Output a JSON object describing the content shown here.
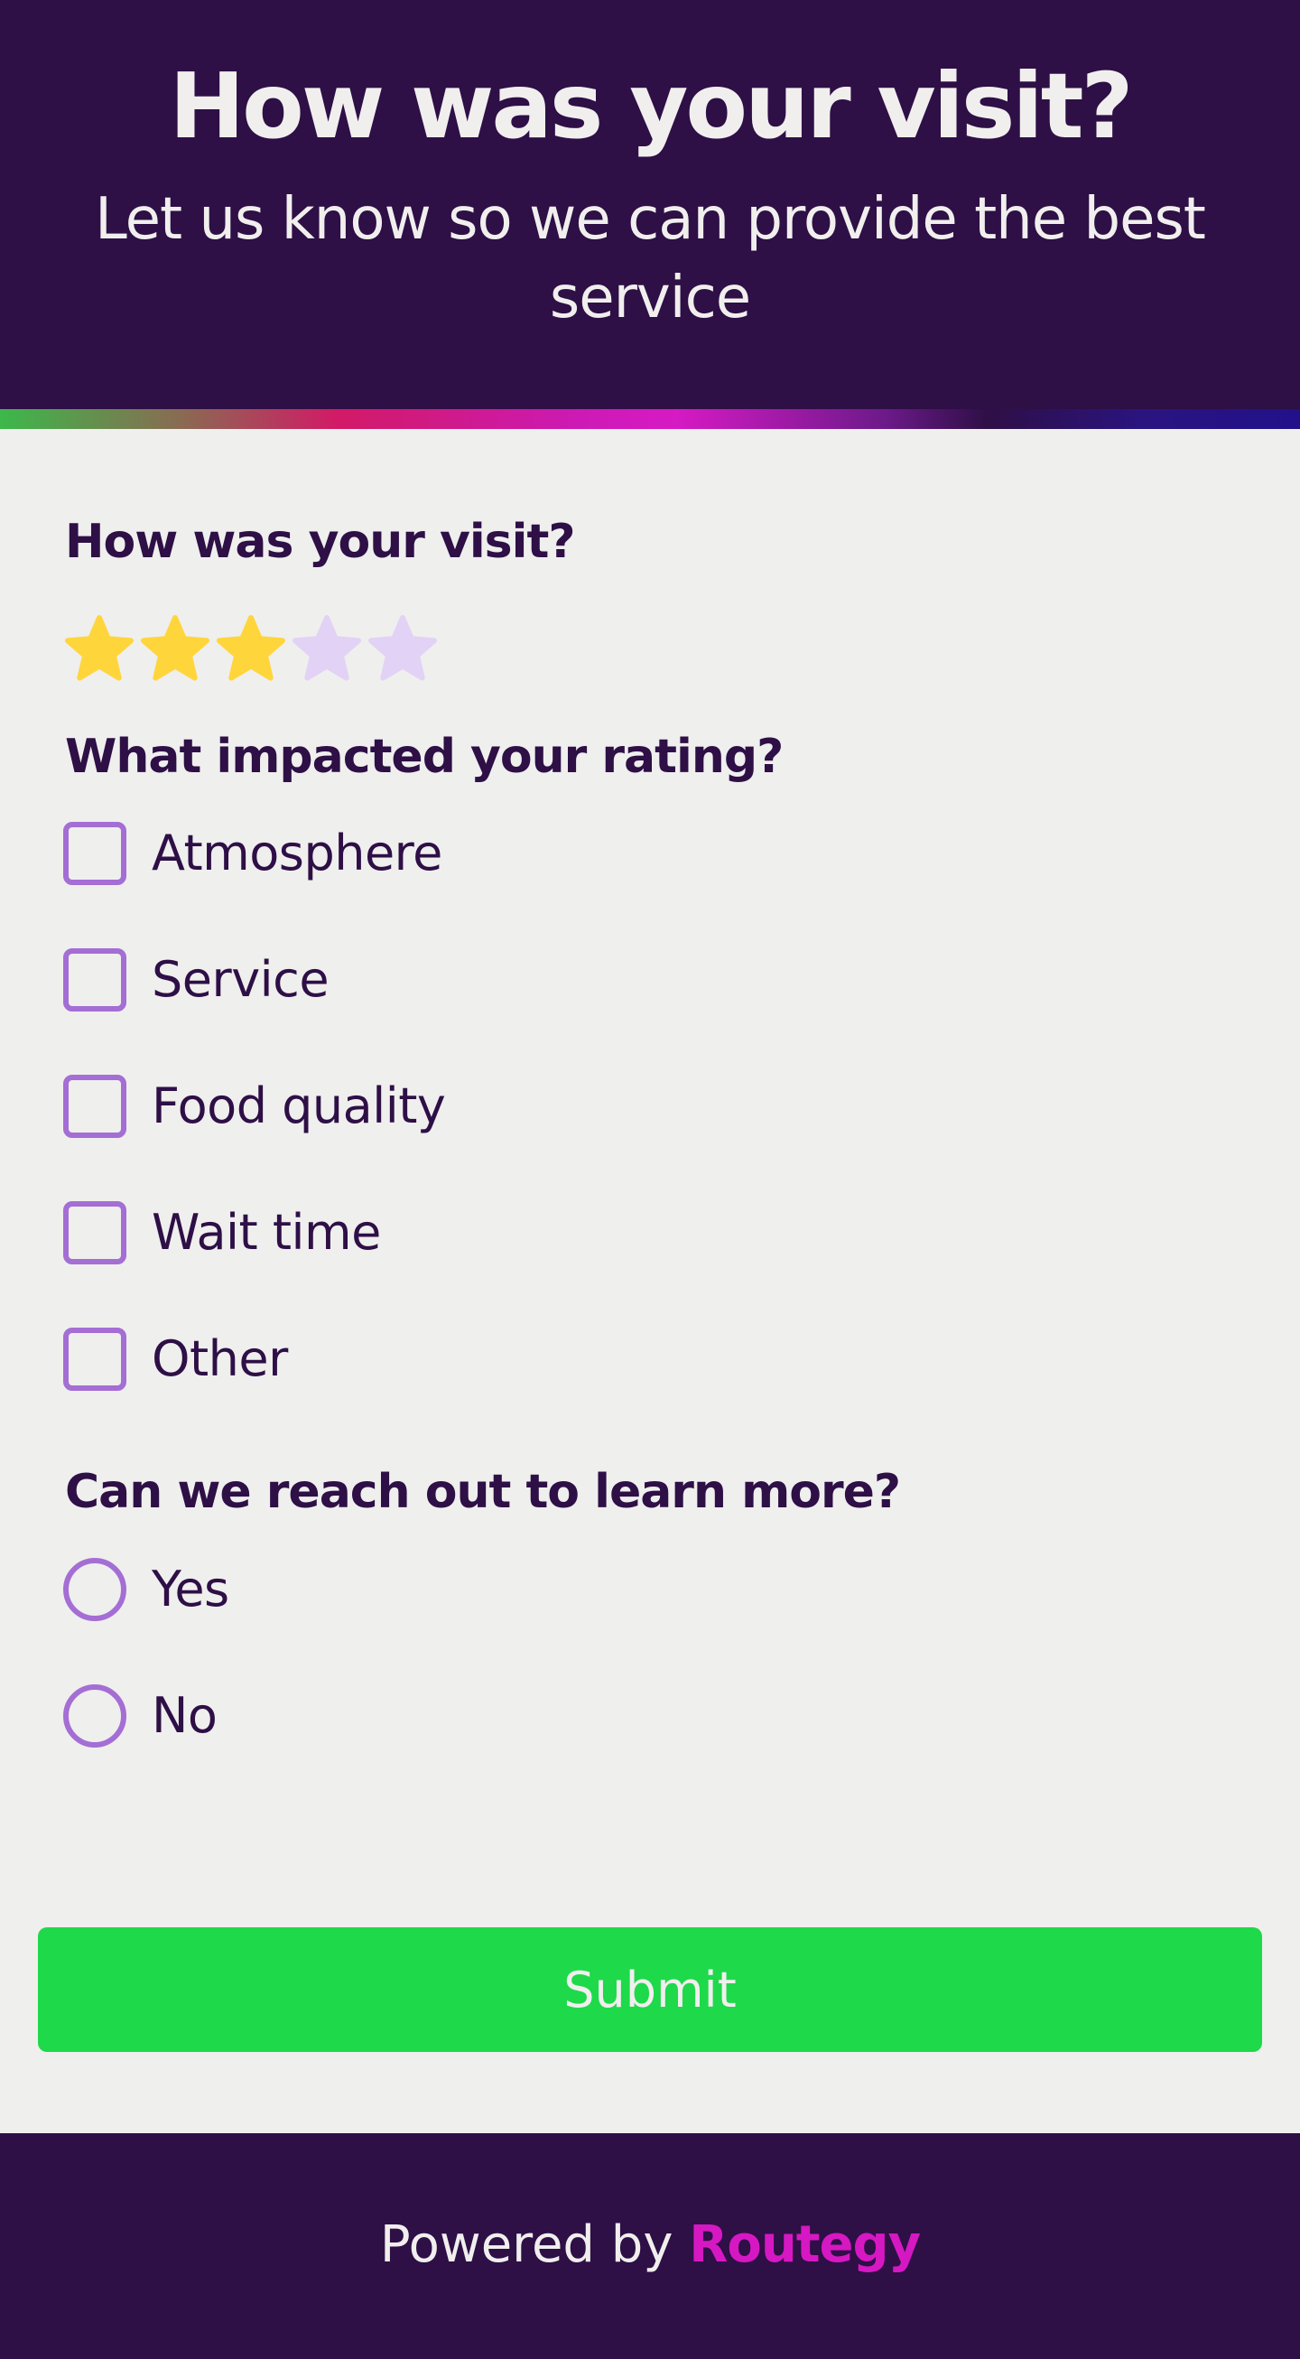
{
  "header": {
    "title": "How was your visit?",
    "subtitle": "Let us know so we can provide the best service"
  },
  "rating": {
    "label": "How was your visit?",
    "value": 3,
    "max": 5,
    "filled_color": "#ffd53c",
    "empty_color": "#e2d2f5"
  },
  "impact": {
    "label": "What impacted your rating?",
    "options": [
      {
        "label": "Atmosphere",
        "checked": false
      },
      {
        "label": "Service",
        "checked": false
      },
      {
        "label": "Food quality",
        "checked": false
      },
      {
        "label": "Wait time",
        "checked": false
      },
      {
        "label": "Other",
        "checked": false
      }
    ]
  },
  "reach_out": {
    "label": "Can we reach out to learn more?",
    "options": [
      {
        "label": "Yes",
        "selected": false
      },
      {
        "label": "No",
        "selected": false
      }
    ]
  },
  "submit": {
    "label": "Submit",
    "color": "#1ed94a"
  },
  "footer": {
    "powered_by": "Powered by",
    "brand": "Routegy",
    "brand_color": "#d618c3"
  },
  "colors": {
    "primary_dark": "#2e0f46",
    "background": "#efefee",
    "control_border": "#a46ed4"
  }
}
